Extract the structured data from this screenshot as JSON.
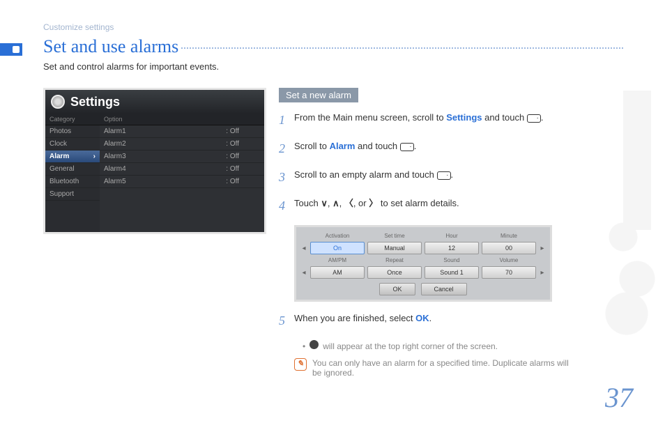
{
  "breadcrumb": "Customize settings",
  "page_title": "Set and use alarms",
  "subtitle": "Set and control alarms for important events.",
  "settings_panel": {
    "title": "Settings",
    "category_header": "Category",
    "option_header": "Option",
    "categories": [
      "Photos",
      "Clock",
      "Alarm",
      "General",
      "Bluetooth",
      "Support"
    ],
    "selected_category": "Alarm",
    "options": [
      {
        "name": "Alarm1",
        "value": ": Off"
      },
      {
        "name": "Alarm2",
        "value": ": Off"
      },
      {
        "name": "Alarm3",
        "value": ": Off"
      },
      {
        "name": "Alarm4",
        "value": ": Off"
      },
      {
        "name": "Alarm5",
        "value": ": Off"
      }
    ]
  },
  "section_heading": "Set a new alarm",
  "steps": {
    "s1a": "From the Main menu screen, scroll to ",
    "s1kw": "Settings",
    "s1b": " and touch ",
    "s2a": "Scroll to ",
    "s2kw": "Alarm",
    "s2b": " and touch ",
    "s3": "Scroll to an empty alarm and touch ",
    "s4a": "Touch ",
    "s4b": " to set alarm details.",
    "s5a": "When you are finished, select ",
    "s5kw": "OK",
    "s5b": "."
  },
  "alarm_detail": {
    "row1_labels": [
      "Activation",
      "Set time",
      "Hour",
      "Minute"
    ],
    "row1_values": [
      "On",
      "Manual",
      "12",
      "00"
    ],
    "row2_labels": [
      "AM/PM",
      "Repeat",
      "Sound",
      "Volume"
    ],
    "row2_values": [
      "AM",
      "Once",
      "Sound 1",
      "70"
    ],
    "ok": "OK",
    "cancel": "Cancel"
  },
  "bullet_text": " will appear at the top right corner of the screen.",
  "note_text": "You can only have an alarm for a specified time. Duplicate alarms will be ignored.",
  "page_number": "37",
  "or_text": ", or ",
  "comma": ", "
}
